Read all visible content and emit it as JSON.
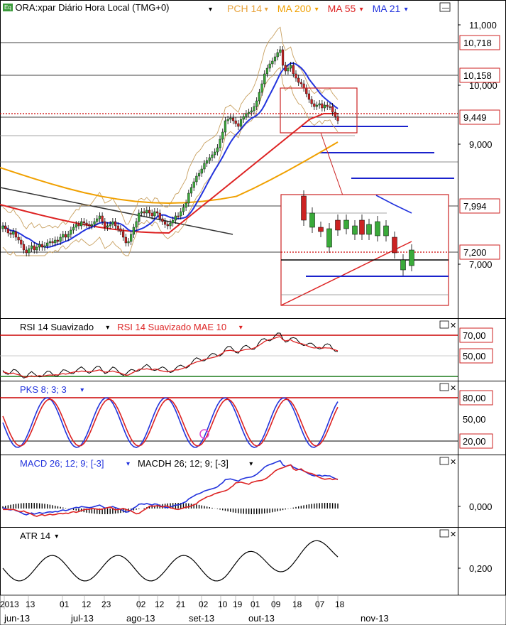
{
  "header": {
    "symbol_badge": "Eq",
    "title": "ORA:xpar Diário Hora Local (TMG+0)",
    "indicators": [
      {
        "label": "PCH 14",
        "color": "#e8a33c"
      },
      {
        "label": "MA 200",
        "color": "#f0a000"
      },
      {
        "label": "MA 55",
        "color": "#dd2222"
      },
      {
        "label": "MA 21",
        "color": "#2233dd"
      }
    ],
    "dropdown_glyph": "▾",
    "minimize_glyph": "—"
  },
  "chart_data": [
    {
      "panel": "price",
      "type": "candlestick",
      "y_ticks": [
        "11,000",
        "10,000",
        "9,000",
        "7,000"
      ],
      "price_tags": [
        "10,718",
        "10,158",
        "9,449",
        "7,994",
        "7,200"
      ],
      "price_tag_colors": [
        "#cc2222",
        "#cc2222",
        "#cc2222",
        "#cc2222",
        "#cc2222"
      ],
      "overlays": [
        "PCH 14",
        "MA 200",
        "MA 55",
        "MA 21"
      ],
      "inset_zoom": true
    },
    {
      "panel": "rsi",
      "type": "line",
      "legend": [
        "RSI 14 Suavizado",
        "RSI 14 Suavizado MAE 10"
      ],
      "legend_colors": [
        "#000000",
        "#dd2222"
      ],
      "levels": [
        "70,00",
        "50,00"
      ]
    },
    {
      "panel": "pks",
      "type": "line",
      "legend": [
        "PKS 8; 3; 3"
      ],
      "levels": [
        "80,00",
        "50,00",
        "20,00"
      ]
    },
    {
      "panel": "macd",
      "type": "line",
      "legend": [
        "MACD 26; 12; 9; [-3]",
        "MACDH 26; 12; 9; [-3]"
      ],
      "levels": [
        "0,000"
      ]
    },
    {
      "panel": "atr",
      "type": "line",
      "legend": [
        "ATR 14"
      ],
      "levels": [
        "0,200"
      ]
    }
  ],
  "x_axis": {
    "days": [
      "2013",
      "13",
      "01",
      "12",
      "23",
      "02",
      "12",
      "21",
      "02",
      "10",
      "19",
      "01",
      "09",
      "18",
      "07",
      "18"
    ],
    "months": [
      "jun-13",
      "jul-13",
      "ago-13",
      "set-13",
      "out-13",
      "nov-13"
    ]
  }
}
